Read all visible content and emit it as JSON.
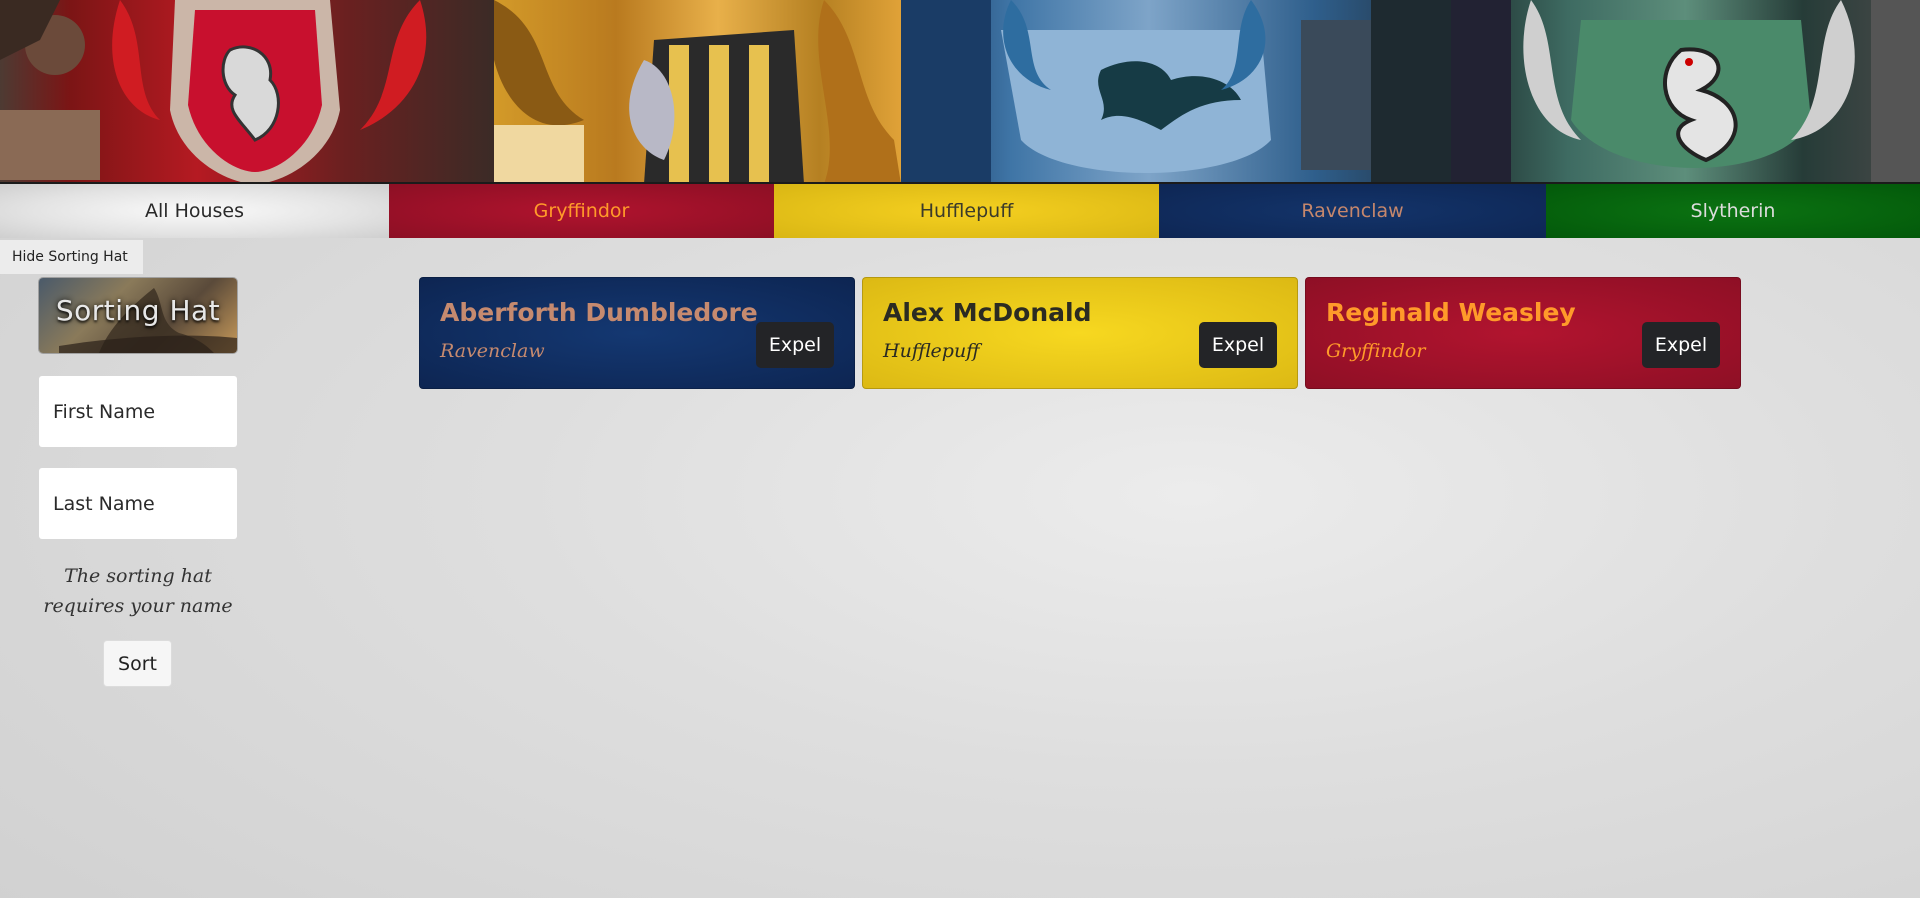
{
  "banner": {
    "crests": [
      "gryffindor-crest",
      "hufflepuff-crest",
      "ravenclaw-crest",
      "slytherin-crest"
    ]
  },
  "nav": {
    "tabs": [
      {
        "label": "All Houses",
        "color": "#2a2a2a",
        "background": "#e3e3e3"
      },
      {
        "label": "Gryffindor",
        "color": "#ff9a2a",
        "background": "#8c0f24"
      },
      {
        "label": "Hufflepuff",
        "color": "#3b3b2a",
        "background": "#f5d020"
      },
      {
        "label": "Ravenclaw",
        "color": "#c6876c",
        "background": "#0e2654"
      },
      {
        "label": "Slytherin",
        "color": "#dcdcdc",
        "background": "#03590a"
      }
    ]
  },
  "sidebar": {
    "toggle_label": "Hide Sorting Hat",
    "hat_title": "Sorting Hat",
    "first_name_placeholder": "First Name",
    "last_name_placeholder": "Last Name",
    "message": "The sorting hat requires your name",
    "sort_label": "Sort"
  },
  "students": [
    {
      "name": "Aberforth Dumbledore",
      "house": "Ravenclaw",
      "expel_label": "Expel"
    },
    {
      "name": "Alex McDonald",
      "house": "Hufflepuff",
      "expel_label": "Expel"
    },
    {
      "name": "Reginald Weasley",
      "house": "Gryffindor",
      "expel_label": "Expel"
    }
  ]
}
